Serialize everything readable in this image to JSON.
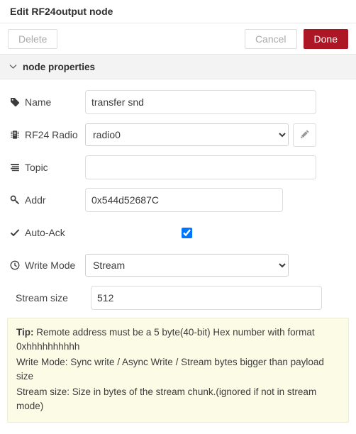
{
  "dialog": {
    "title": "Edit RF24output node"
  },
  "toolbar": {
    "delete_label": "Delete",
    "cancel_label": "Cancel",
    "done_label": "Done",
    "done_color": "#ad1625"
  },
  "section": {
    "chevron_icon": "chevron-down-icon",
    "title": "node properties"
  },
  "form": {
    "rows": [
      {
        "id": "name",
        "icon": "tag-icon",
        "label": "Name",
        "value": "transfer snd",
        "placeholder": "Name"
      },
      {
        "id": "rf24-radio",
        "icon": "microchip-icon",
        "label": "RF24 Radio",
        "value": "radio0",
        "options": [
          "radio0"
        ],
        "edit_icon": "pencil-icon"
      },
      {
        "id": "topic",
        "icon": "list-icon",
        "label": "Topic",
        "value": "",
        "placeholder": ""
      },
      {
        "id": "addr",
        "icon": "key-icon",
        "label": "Addr",
        "value": "0x544d52687C",
        "placeholder": ""
      },
      {
        "id": "auto-ack",
        "icon": "check-icon",
        "label": "Auto-Ack",
        "checked": true
      },
      {
        "id": "write-mode",
        "icon": "clock-icon",
        "label": "Write Mode",
        "value": "Stream",
        "options": [
          "Sync write",
          "Async Write",
          "Stream"
        ]
      },
      {
        "id": "stream-size",
        "icon": "",
        "label": "Stream size",
        "value": "512",
        "placeholder": ""
      }
    ]
  },
  "tip": {
    "prefix": "Tip:",
    "line1": " Remote address must be a 5 byte(40-bit) Hex number with format 0xhhhhhhhhhh",
    "line2": "Write Mode: Sync write / Async Write / Stream bytes bigger than payload size",
    "line3": "Stream size: Size in bytes of the stream chunk.(ignored if not in stream mode)"
  }
}
